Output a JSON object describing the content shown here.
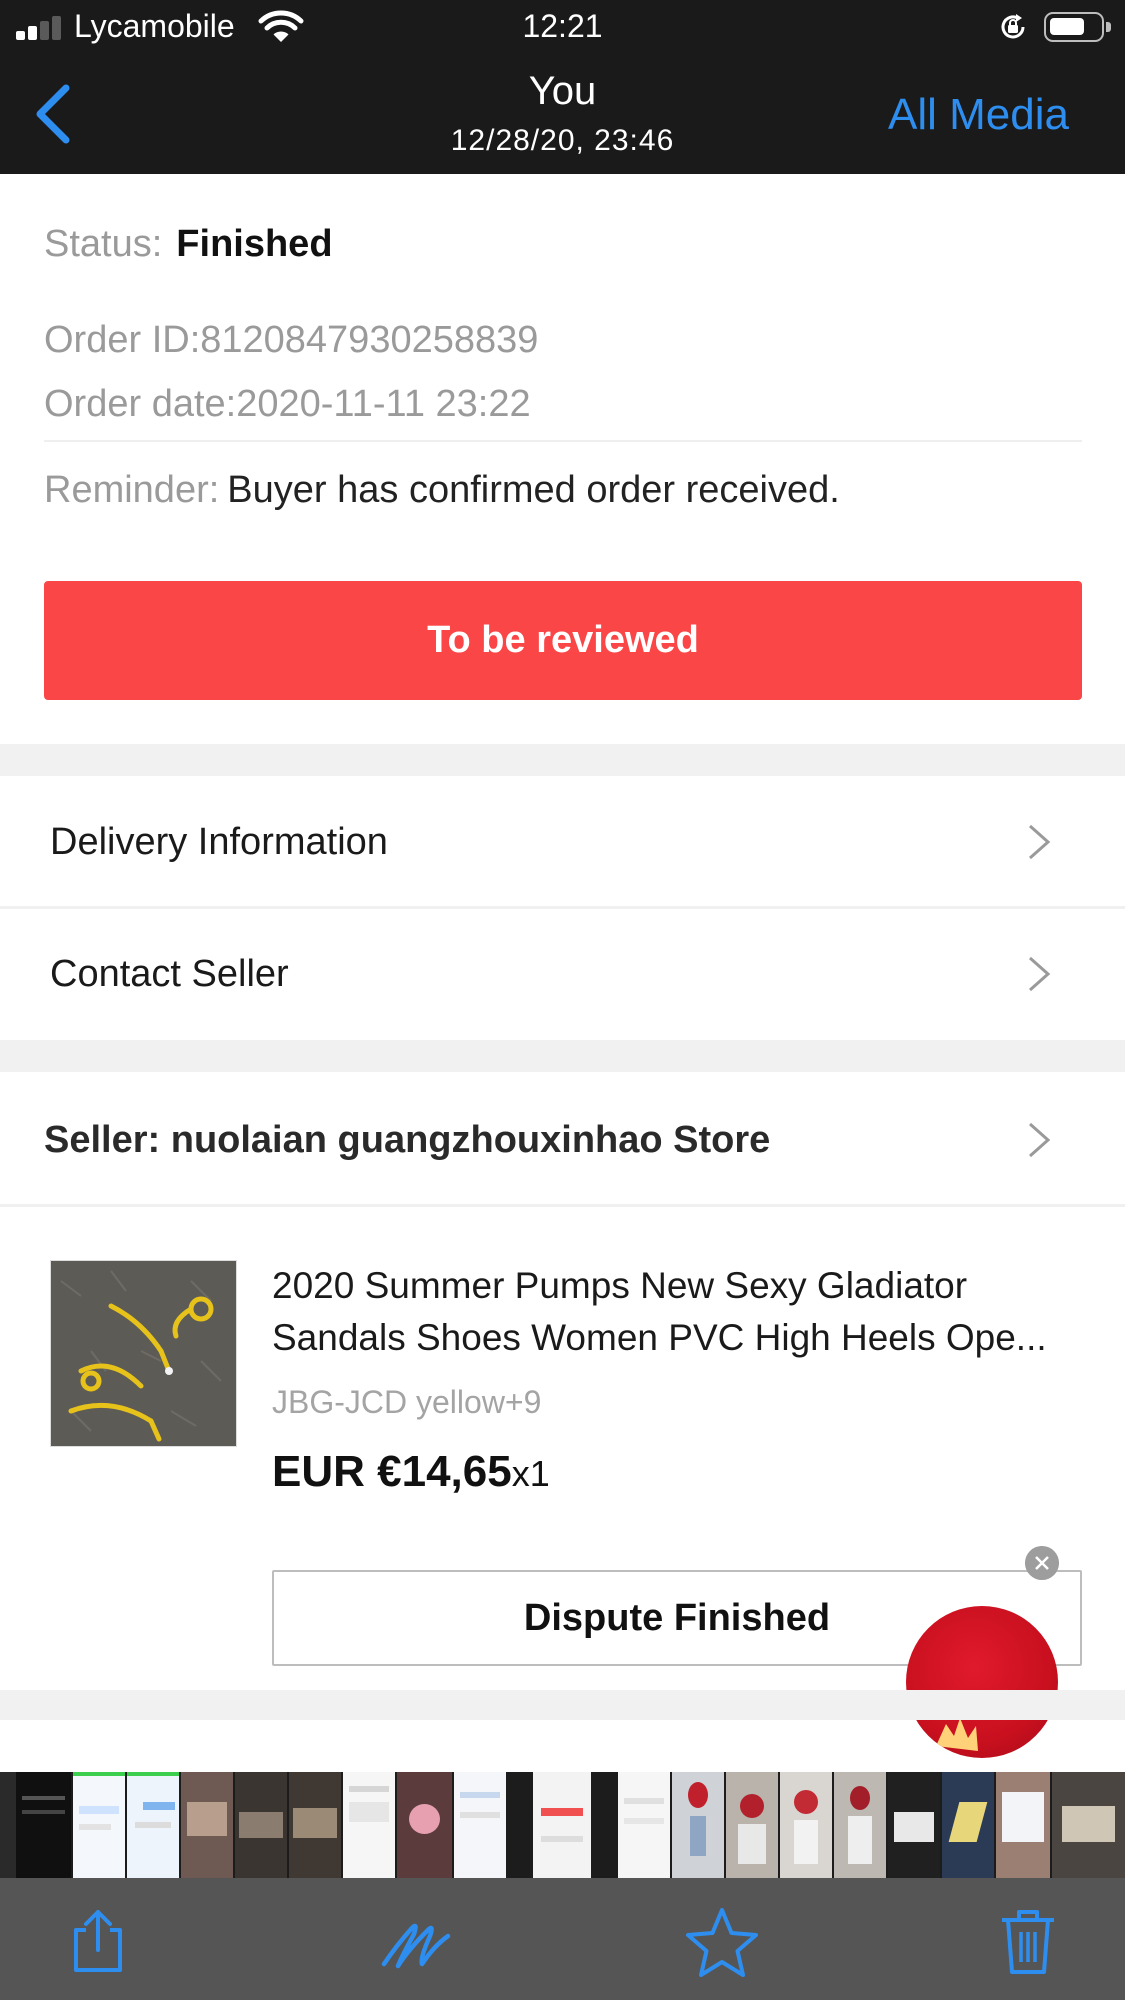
{
  "status_bar": {
    "carrier": "Lycamobile",
    "time": "12:21",
    "signal_bars": 2,
    "battery_level": 0.7
  },
  "nav": {
    "title": "You",
    "subtitle": "12/28/20, 23:46",
    "right_button": "All Media",
    "back_icon": "chevron-left-icon",
    "accent_color": "#2e8ef0"
  },
  "order": {
    "status_label": "Status:",
    "status_value": "Finished",
    "order_id": "Order ID:8120847930258839",
    "order_date": "Order date:2020-11-11 23:22",
    "reminder_label": "Reminder:",
    "reminder_text": "Buyer has confirmed order received.",
    "review_button": "To be reviewed",
    "review_button_color": "#fa4646"
  },
  "links": {
    "delivery": "Delivery Information",
    "contact": "Contact Seller"
  },
  "seller": {
    "label": "Seller: nuolaian guangzhouxinhao Store"
  },
  "product": {
    "title_line1": "2020 Summer Pumps New Sexy Gladiator",
    "title_line2": "Sandals Shoes Women PVC High Heels Ope...",
    "sku": "JBG-JCD yellow+9",
    "price": "EUR €14,65",
    "quantity": "x1",
    "dispute_button": "Dispute Finished"
  },
  "toolbar": {
    "icons": [
      "share-icon",
      "markup-icon",
      "favorite-star-icon",
      "trash-icon"
    ],
    "icon_color": "#2e8ef0"
  }
}
